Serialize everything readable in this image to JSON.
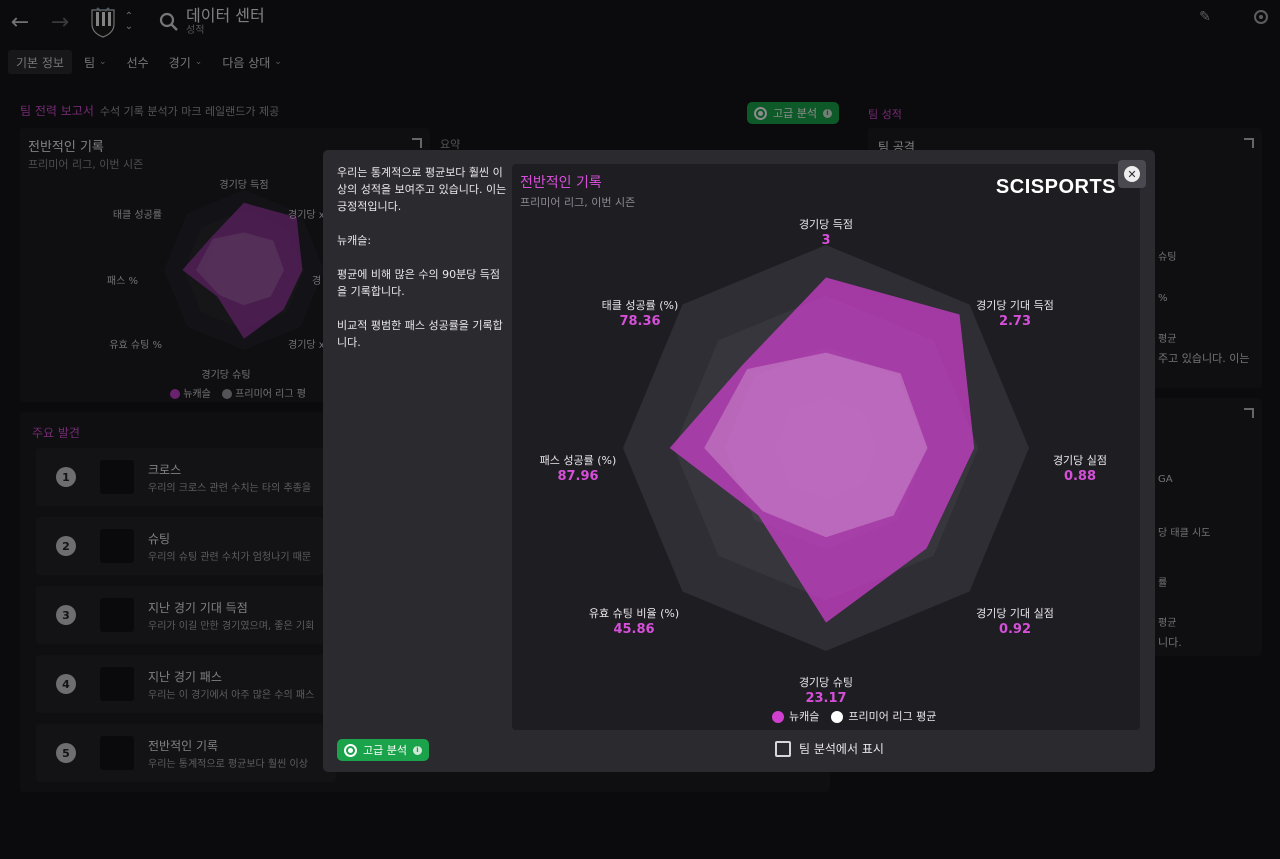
{
  "header": {
    "title": "데이터 센터",
    "subtitle": "성적"
  },
  "tabs": [
    {
      "label": "기본 정보",
      "dropdown": false
    },
    {
      "label": "팀",
      "dropdown": true
    },
    {
      "label": "선수",
      "dropdown": false
    },
    {
      "label": "경기",
      "dropdown": true
    },
    {
      "label": "다음 상대",
      "dropdown": true
    }
  ],
  "background": {
    "report_title": "팀 전력 보고서",
    "report_sub": "수석 기록 분석가 마크 레일랜드가 제공",
    "advanced_label": "고급 분석",
    "team_stats_link": "팀 성적",
    "overall_card_title": "전반적인 기록",
    "overall_card_sub": "프리미어 리그, 이번 시즌",
    "summary_label": "요약",
    "team_attack_label": "팀 공격",
    "mini_axes": [
      "경기당 득점",
      "경기당 x",
      "경",
      "경기당 x",
      "경기당 슈팅",
      "유효 슈팅 %",
      "패스 %",
      "태클 성공률"
    ],
    "mini_legend": [
      "뉴캐슬",
      "프리미어 리그 평"
    ],
    "key_findings_title": "주요 발견",
    "right_fragments": [
      "슈팅",
      "%",
      "평균",
      "주고 있습니다. 이는",
      "GA",
      "당 태클 시도",
      "률",
      "평균",
      "니다."
    ],
    "findings": [
      {
        "num": "1",
        "title": "크로스",
        "desc": "우리의 크로스 관련 수치는 타의 추종을"
      },
      {
        "num": "2",
        "title": "슈팅",
        "desc": "우리의 슈팅 관련 수치가 엄청나기 때문"
      },
      {
        "num": "3",
        "title": "지난 경기 기대 득점",
        "desc": "우리가 이길 만한 경기였으며, 좋은 기회"
      },
      {
        "num": "4",
        "title": "지난 경기 패스",
        "desc": "우리는 이 경기에서 아주 많은 수의 패스"
      },
      {
        "num": "5",
        "title": "전반적인 기록",
        "desc": "우리는 통계적으로 평균보다 훨씬 이상"
      }
    ]
  },
  "modal": {
    "text_paragraphs": [
      "우리는 통계적으로 평균보다 훨씬 이상의 성적을 보여주고 있습니다. 이는 긍정적입니다.",
      "뉴캐슬:",
      "평균에 비해 많은 수의 90분당 득점을 기록합니다.",
      "비교적 평범한 패스 성공률을 기록합니다."
    ],
    "chart_title": "전반적인 기록",
    "chart_sub": "프리미어 리그, 이번 시즌",
    "brand": "SCISPORTS",
    "advanced_label": "고급 분석",
    "show_in_team_analysis": "팀 분석에서 표시"
  },
  "colors": {
    "accent": "#d54fd8",
    "team_fill": "#b73fbf",
    "league_fill": "#e9d6ee",
    "green": "#1aa34a"
  },
  "chart_data": {
    "type": "radar",
    "axes": [
      {
        "label": "경기당 득점",
        "value": "3",
        "team": 0.84,
        "league": 0.47
      },
      {
        "label": "경기당 기대 득점",
        "value": "2.73",
        "team": 0.93,
        "league": 0.52
      },
      {
        "label": "경기당 실점",
        "value": "0.88",
        "team": 0.73,
        "league": 0.5
      },
      {
        "label": "경기당 기대 실점",
        "value": "0.92",
        "team": 0.7,
        "league": 0.47
      },
      {
        "label": "경기당 슈팅",
        "value": "23.17",
        "team": 0.86,
        "league": 0.44
      },
      {
        "label": "유효 슈팅 비율 (%)",
        "value": "45.86",
        "team": 0.47,
        "league": 0.44
      },
      {
        "label": "패스 성공률 (%)",
        "value": "87.96",
        "team": 0.77,
        "league": 0.6
      },
      {
        "label": "태클 성공률 (%)",
        "value": "78.36",
        "team": 0.58,
        "league": 0.55
      }
    ],
    "series": [
      {
        "name": "뉴캐슬",
        "color": "#d040d0"
      },
      {
        "name": "프리미어 리그 평균",
        "color": "#ffffff"
      }
    ],
    "rings": 4
  }
}
